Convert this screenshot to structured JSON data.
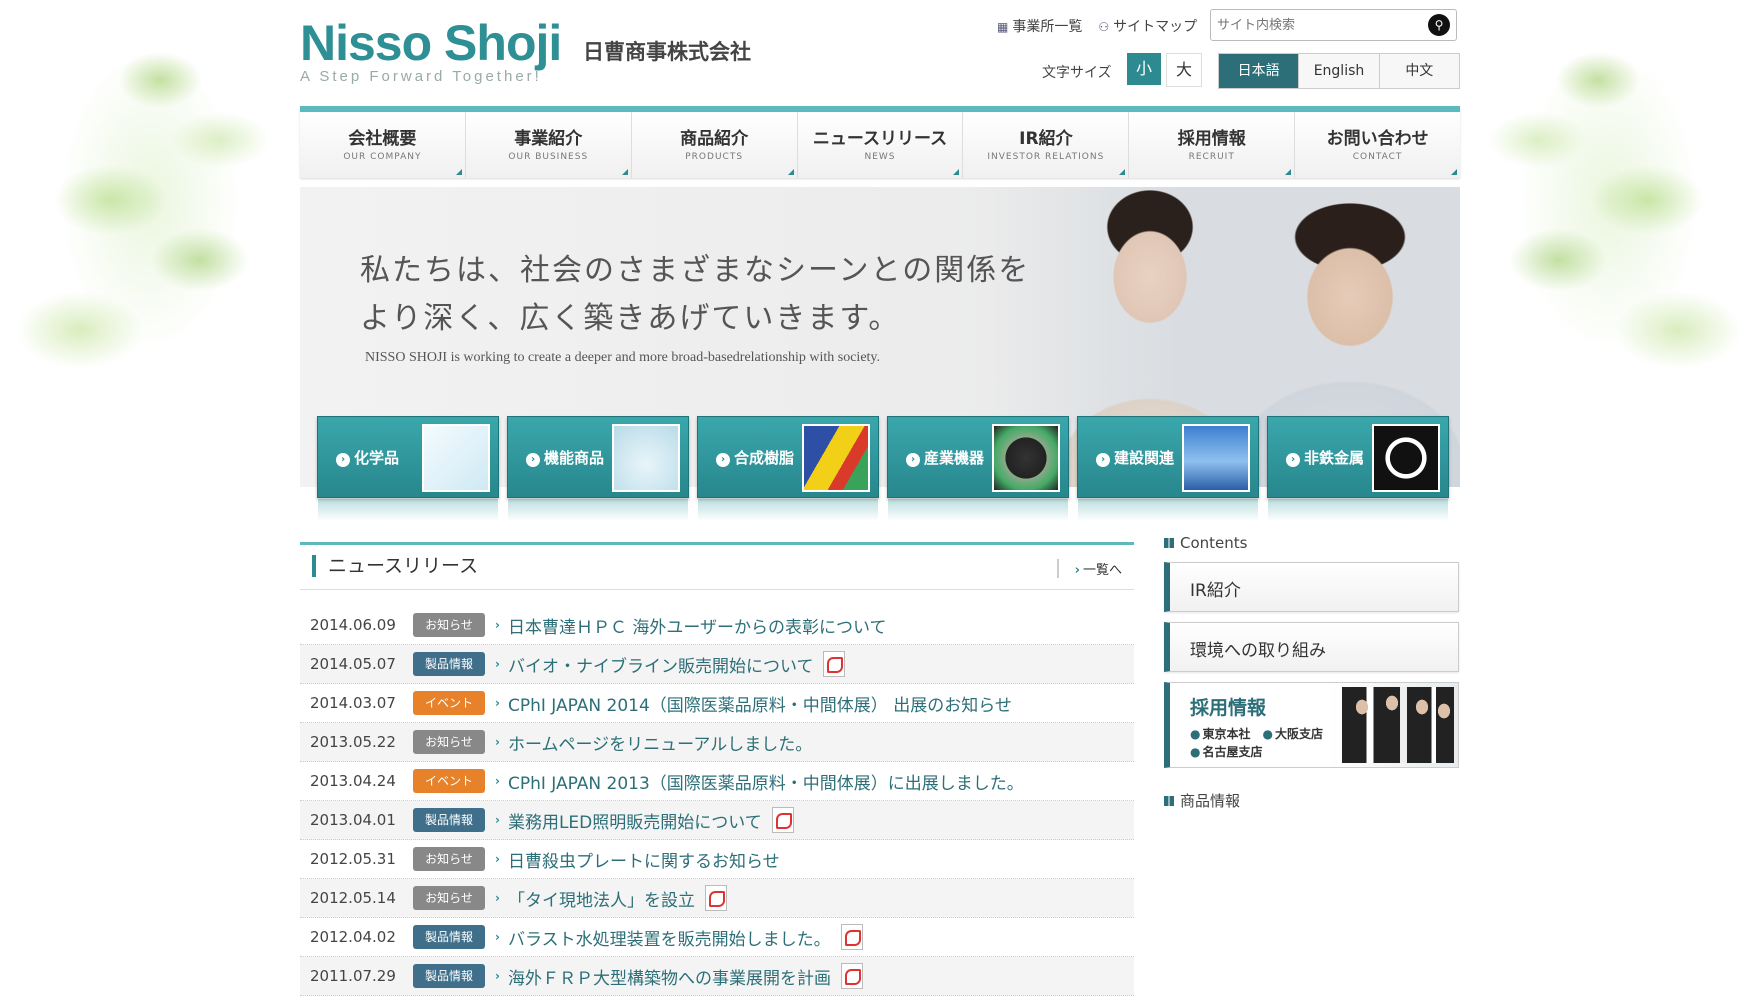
{
  "header": {
    "logo_text": "Nisso Shoji",
    "tagline": "A Step Forward Together!",
    "company_name": "日曹商事株式会社",
    "util_links": [
      {
        "label": "事業所一覧",
        "icon": "building-icon"
      },
      {
        "label": "サイトマップ",
        "icon": "sitemap-icon"
      }
    ],
    "search_placeholder": "サイト内検索",
    "font_size_label": "文字サイズ",
    "font_small": "小",
    "font_large": "大",
    "languages": [
      "日本語",
      "English",
      "中文"
    ],
    "active_language": "日本語"
  },
  "nav": [
    {
      "jp": "会社概要",
      "en": "OUR COMPANY"
    },
    {
      "jp": "事業紹介",
      "en": "OUR BUSINESS"
    },
    {
      "jp": "商品紹介",
      "en": "PRODUCTS"
    },
    {
      "jp": "ニュースリリース",
      "en": "NEWS"
    },
    {
      "jp": "IR紹介",
      "en": "INVESTOR RELATIONS"
    },
    {
      "jp": "採用情報",
      "en": "RECRUIT"
    },
    {
      "jp": "お問い合わせ",
      "en": "CONTACT"
    }
  ],
  "hero": {
    "line1": "私たちは、社会のさまざまなシーンとの関係を",
    "line2": "より深く、広く築きあげていきます。",
    "english": "NISSO SHOJI is working to create a deeper and more broad-basedrelationship with society."
  },
  "categories": [
    "化学品",
    "機能商品",
    "合成樹脂",
    "産業機器",
    "建設関連",
    "非鉄金属"
  ],
  "news": {
    "title": "ニュースリリース",
    "more": "一覧へ",
    "items": [
      {
        "date": "2014.06.09",
        "badge": "お知らせ",
        "type": "info",
        "text": "日本曹達ＨＰＣ 海外ユーザーからの表彰について",
        "pdf": false
      },
      {
        "date": "2014.05.07",
        "badge": "製品情報",
        "type": "prod",
        "text": "バイオ・ナイブライン販売開始について",
        "pdf": true
      },
      {
        "date": "2014.03.07",
        "badge": "イベント",
        "type": "event",
        "text": "CPhI JAPAN 2014（国際医薬品原料・中間体展） 出展のお知らせ",
        "pdf": false
      },
      {
        "date": "2013.05.22",
        "badge": "お知らせ",
        "type": "info",
        "text": "ホームページをリニューアルしました。",
        "pdf": false
      },
      {
        "date": "2013.04.24",
        "badge": "イベント",
        "type": "event",
        "text": "CPhI JAPAN 2013（国際医薬品原料・中間体展）に出展しました。",
        "pdf": false
      },
      {
        "date": "2013.04.01",
        "badge": "製品情報",
        "type": "prod",
        "text": "業務用LED照明販売開始について",
        "pdf": true
      },
      {
        "date": "2012.05.31",
        "badge": "お知らせ",
        "type": "info",
        "text": "日曹殺虫プレートに関するお知らせ",
        "pdf": false
      },
      {
        "date": "2012.05.14",
        "badge": "お知らせ",
        "type": "info",
        "text": "「タイ現地法人」を設立",
        "pdf": true
      },
      {
        "date": "2012.04.02",
        "badge": "製品情報",
        "type": "prod",
        "text": "バラスト水処理装置を販売開始しました。",
        "pdf": true
      },
      {
        "date": "2011.07.29",
        "badge": "製品情報",
        "type": "prod",
        "text": "海外ＦＲＰ大型構築物への事業展開を計画",
        "pdf": true
      }
    ]
  },
  "sidebar": {
    "contents_heading": "Contents",
    "buttons": [
      "IR紹介",
      "環境への取り組み"
    ],
    "recruit_title": "採用情報",
    "recruit_offices": [
      "東京本社",
      "大阪支店",
      "名古屋支店"
    ],
    "products_heading": "商品情報"
  }
}
